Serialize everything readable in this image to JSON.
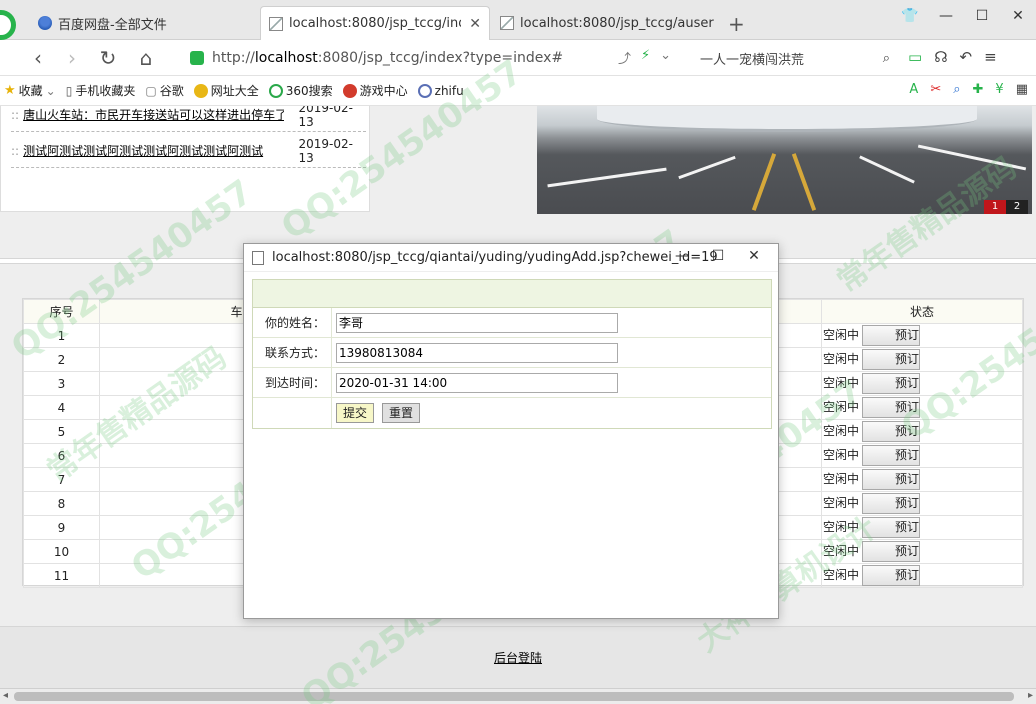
{
  "browser": {
    "tabs": [
      {
        "title": "百度网盘-全部文件",
        "icon": "baidu-netdisk-icon",
        "active": false
      },
      {
        "title": "localhost:8080/jsp_tccg/index",
        "icon": "page-icon",
        "active": true
      },
      {
        "title": "localhost:8080/jsp_tccg/auser",
        "icon": "page-icon",
        "active": false
      }
    ],
    "url_prefix": "http://",
    "url_host": "localhost",
    "url_rest": ":8080/jsp_tccg/index?type=index#",
    "search_text": "一人一宠横闯洪荒",
    "bookmarks": [
      {
        "label": "收藏",
        "icon": "star-icon"
      },
      {
        "label": "手机收藏夹",
        "icon": "phone-icon"
      },
      {
        "label": "谷歌",
        "icon": "doc-icon"
      },
      {
        "label": "网址大全",
        "icon": "compass-icon"
      },
      {
        "label": "360搜索",
        "icon": "search360-icon"
      },
      {
        "label": "游戏中心",
        "icon": "game-icon"
      },
      {
        "label": "zhifu",
        "icon": "globe-icon"
      }
    ]
  },
  "news": [
    {
      "title": "唐山火车站：市民开车接送站可以这样进出停车了",
      "date": "2019-02-13"
    },
    {
      "title": "测试阿测试测试阿测试测试阿测试测试阿测试",
      "date": "2019-02-13"
    }
  ],
  "banner": {
    "pages": [
      "1",
      "2"
    ],
    "current_page": "1"
  },
  "table": {
    "headers": {
      "index": "序号",
      "car": "车位",
      "status": "状态"
    },
    "rows": [
      {
        "index": "1",
        "status": "空闲中",
        "action": "预订"
      },
      {
        "index": "2",
        "status": "空闲中",
        "action": "预订"
      },
      {
        "index": "3",
        "status": "空闲中",
        "action": "预订"
      },
      {
        "index": "4",
        "status": "空闲中",
        "action": "预订"
      },
      {
        "index": "5",
        "status": "空闲中",
        "action": "预订"
      },
      {
        "index": "6",
        "status": "空闲中",
        "action": "预订"
      },
      {
        "index": "7",
        "status": "空闲中",
        "action": "预订"
      },
      {
        "index": "8",
        "status": "空闲中",
        "action": "预订"
      },
      {
        "index": "9",
        "status": "空闲中",
        "action": "预订"
      },
      {
        "index": "10",
        "status": "空闲中",
        "action": "预订"
      },
      {
        "index": "11",
        "status": "空闲中",
        "action": "预订"
      }
    ]
  },
  "footer": {
    "admin_login": "后台登陆"
  },
  "popup": {
    "title": "localhost:8080/jsp_tccg/qiantai/yuding/yudingAdd.jsp?chewei_id=19",
    "fields": {
      "name_label": "你的姓名：",
      "name_value": "李哥",
      "phone_label": "联系方式：",
      "phone_value": "13980813084",
      "arrival_label": "到达时间：",
      "arrival_value": "2020-01-31 14:00"
    },
    "submit_label": "提交",
    "reset_label": "重置"
  },
  "watermark": {
    "qq": "QQ:254540457",
    "texts": [
      "大神计算机设计",
      "常年售精品源码"
    ]
  },
  "colors": {
    "accent_green": "#27b34b",
    "banner_pager_active": "#c0161b",
    "form_header_bg": "#eef5e2"
  }
}
